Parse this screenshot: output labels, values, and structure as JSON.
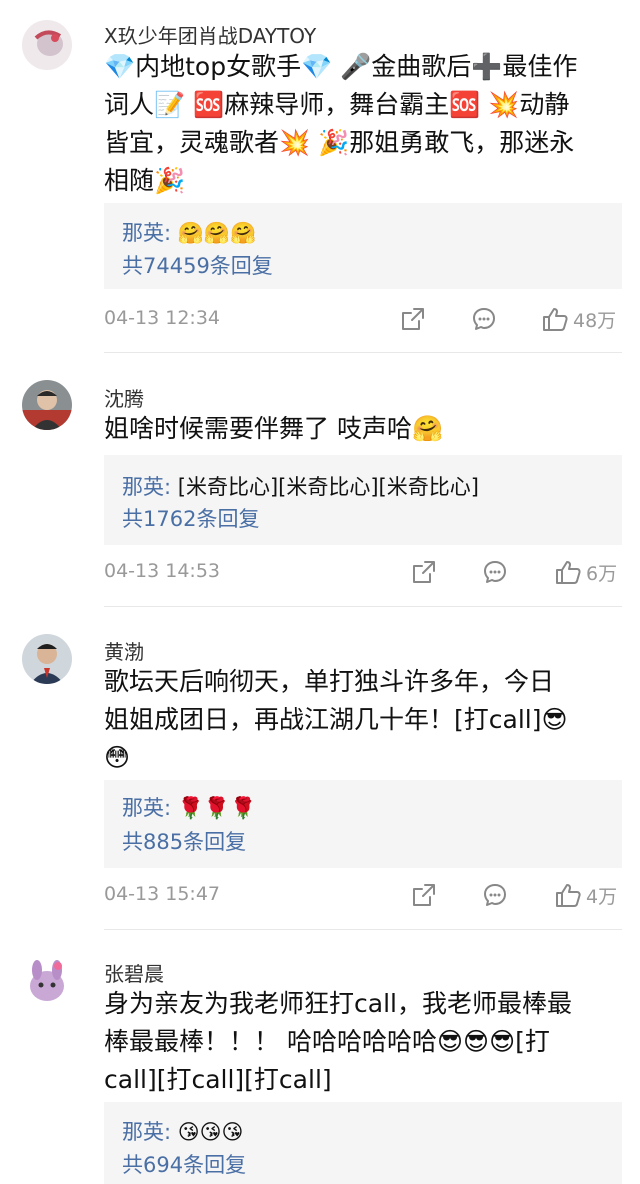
{
  "comments": [
    {
      "username": "X玖少年团肖战DAYTOY",
      "text_lines": [
        "💎内地top女歌手💎 🎤金曲歌后➕最佳作",
        "词人📝 🆘麻辣导师，舞台霸主🆘 💥动静",
        "皆宜，灵魂歌者💥 🎉那姐勇敢飞，那迷永",
        "相随🎉"
      ],
      "reply_author": "那英:",
      "reply_content": "🤗🤗🤗",
      "reply_count": "共74459条回复",
      "time": "04-13 12:34",
      "likes": "48万"
    },
    {
      "username": "沈腾",
      "text_lines": [
        "姐啥时候需要伴舞了 吱声哈🤗"
      ],
      "reply_author": "那英:",
      "reply_content": "[米奇比心][米奇比心][米奇比心]",
      "reply_count": "共1762条回复",
      "time": "04-13 14:53",
      "likes": "6万"
    },
    {
      "username": "黄渤",
      "text_lines": [
        "歌坛天后响彻天，单打独斗许多年，今日",
        "姐姐成团日，再战江湖几十年！[打call]😎",
        "😳"
      ],
      "reply_author": "那英:",
      "reply_content": "🌹🌹🌹",
      "reply_count": "共885条回复",
      "time": "04-13 15:47",
      "likes": "4万"
    },
    {
      "username": "张碧晨",
      "text_lines": [
        "身为亲友为我老师狂打call，我老师最棒最",
        "棒最最棒！！！ 哈哈哈哈哈哈😎😎😎[打",
        "call][打call][打call]"
      ],
      "reply_author": "那英:",
      "reply_content": "😘😘😘",
      "reply_count": "共694条回复"
    }
  ],
  "colors": {
    "link": "#4a6fa5",
    "muted": "#999999",
    "reply_bg": "#f5f5f5"
  },
  "icons": [
    "share-icon",
    "comment-icon",
    "like-icon"
  ]
}
